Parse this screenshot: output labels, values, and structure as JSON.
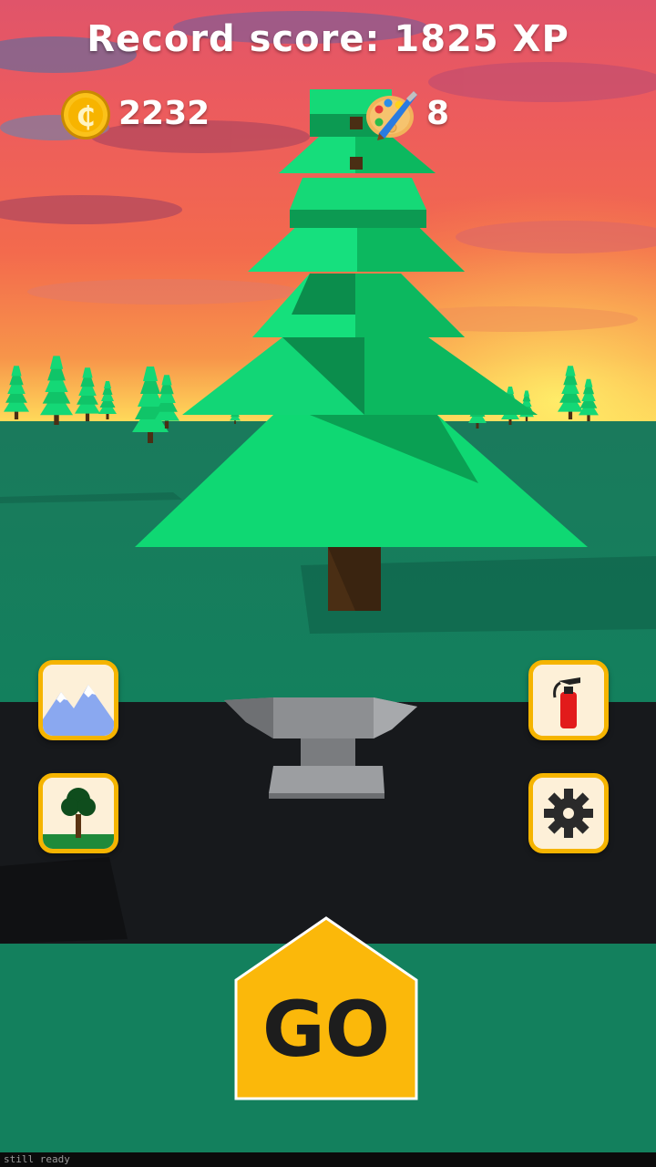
{
  "hud": {
    "record_label": "Record score: 1825 XP",
    "coins": "2232",
    "coin_symbol": "₵",
    "palette_count": "8"
  },
  "buttons": {
    "go_label": "GO",
    "left_top_icon": "mountain-icon",
    "left_bottom_icon": "tree-icon",
    "right_top_icon": "fire-extinguisher-icon",
    "right_bottom_icon": "gear-icon"
  },
  "status_bar": {
    "text": "still ready"
  },
  "colors": {
    "button_border": "#f5b400",
    "button_fill": "#fdf0d8",
    "go_fill": "#fbb80a",
    "grass": "#13805d",
    "road": "#17191c",
    "tree_green": "#0fd873"
  }
}
